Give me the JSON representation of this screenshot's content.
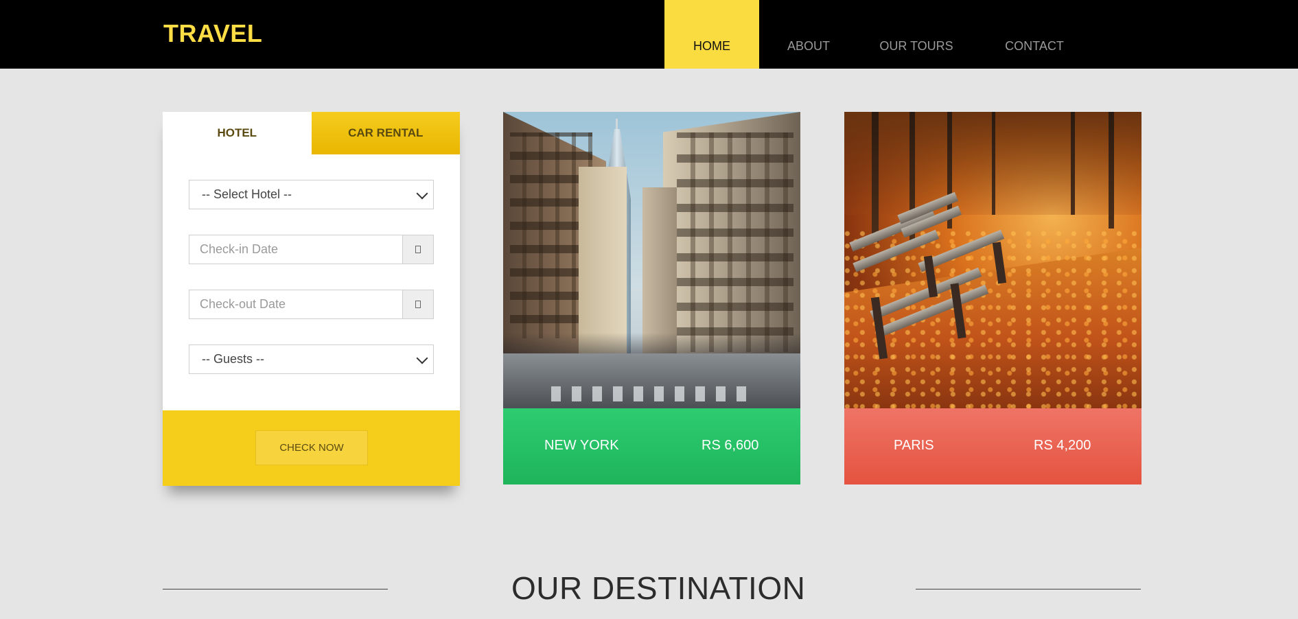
{
  "brand": "TRAVEL",
  "nav": [
    {
      "label": "HOME",
      "active": true
    },
    {
      "label": "ABOUT",
      "active": false
    },
    {
      "label": "OUR TOURS",
      "active": false
    },
    {
      "label": "CONTACT",
      "active": false
    }
  ],
  "booking": {
    "tabs": [
      {
        "label": "HOTEL",
        "active": true
      },
      {
        "label": "CAR RENTAL",
        "active": false
      }
    ],
    "hotel_select": "-- Select Hotel --",
    "checkin_placeholder": "Check-in Date",
    "checkout_placeholder": "Check-out Date",
    "guests_select": "-- Guests --",
    "calendar_icon": "calendar-icon",
    "button_label": "CHECK NOW"
  },
  "cards": [
    {
      "name": "NEW YORK",
      "price": "RS 6,600",
      "color": "#2ecc71"
    },
    {
      "name": "PARIS",
      "price": "RS 4,200",
      "color": "#ea6150"
    }
  ],
  "section_title": "OUR DESTINATION",
  "colors": {
    "accent": "#fbdc40",
    "header_bg": "#000000",
    "page_bg": "#e5e5e5"
  }
}
